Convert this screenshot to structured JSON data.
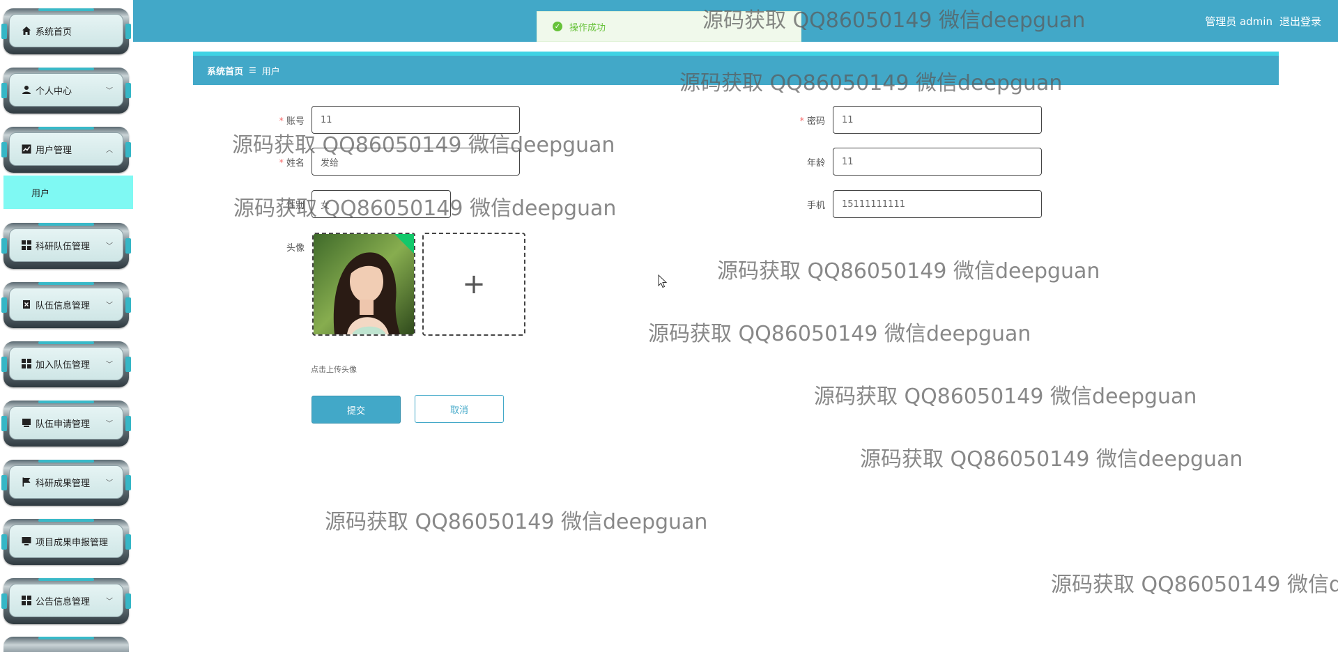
{
  "sidebar": {
    "items": [
      {
        "label": "系统首页",
        "icon": "home-icon",
        "chevron": ""
      },
      {
        "label": "个人中心",
        "icon": "user-icon",
        "chevron": "﹀"
      },
      {
        "label": "用户管理",
        "icon": "chart-icon",
        "chevron": "︿"
      },
      {
        "label": "科研队伍管理",
        "icon": "grid-icon",
        "chevron": "﹀"
      },
      {
        "label": "队伍信息管理",
        "icon": "delete-icon",
        "chevron": "﹀"
      },
      {
        "label": "加入队伍管理",
        "icon": "grid-icon",
        "chevron": "﹀"
      },
      {
        "label": "队伍申请管理",
        "icon": "box-icon",
        "chevron": "﹀"
      },
      {
        "label": "科研成果管理",
        "icon": "flag-icon",
        "chevron": "﹀"
      },
      {
        "label": "项目成果申报管理",
        "icon": "monitor-icon",
        "chevron": ""
      },
      {
        "label": "公告信息管理",
        "icon": "grid-icon",
        "chevron": "﹀"
      }
    ],
    "active_sub": "用户"
  },
  "header": {
    "user_label": "管理员 admin",
    "logout_label": "退出登录",
    "toast": "操作成功"
  },
  "breadcrumb": {
    "home": "系统首页",
    "separator": "☰",
    "current": "用户"
  },
  "form": {
    "account": {
      "label": "账号",
      "value": "11"
    },
    "password": {
      "label": "密码",
      "value": "11"
    },
    "name": {
      "label": "姓名",
      "value": "发给"
    },
    "age": {
      "label": "年龄",
      "value": "11"
    },
    "gender": {
      "label": "性别",
      "value": "女"
    },
    "phone": {
      "label": "手机",
      "value": "15111111111"
    },
    "avatar_label": "头像",
    "upload_plus": "+",
    "upload_hint": "点击上传头像",
    "submit_label": "提交",
    "cancel_label": "取消"
  },
  "watermark": "源码获取 QQ86050149 微信deepguan",
  "colors": {
    "primary": "#42a8c8",
    "active_sub": "#7ff9f3",
    "toast_text": "#67c23a"
  }
}
